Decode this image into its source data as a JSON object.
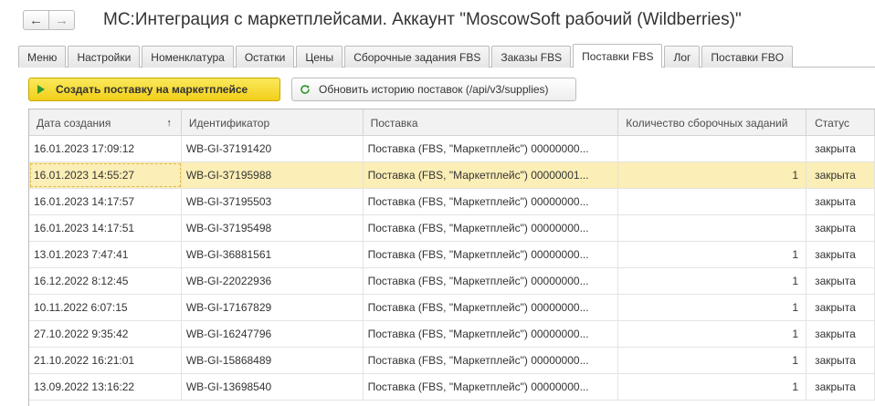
{
  "window": {
    "title": "МС:Интеграция с маркетплейсами. Аккаунт \"MoscowSoft рабочий (Wildberries)\"",
    "back_icon": "arrow-left-icon",
    "forward_icon": "arrow-right-icon"
  },
  "tabs": [
    {
      "label": "Меню",
      "active": false
    },
    {
      "label": "Настройки",
      "active": false
    },
    {
      "label": "Номенклатура",
      "active": false
    },
    {
      "label": "Остатки",
      "active": false
    },
    {
      "label": "Цены",
      "active": false
    },
    {
      "label": "Сборочные задания FBS",
      "active": false
    },
    {
      "label": "Заказы FBS",
      "active": false
    },
    {
      "label": "Поставки FBS",
      "active": true
    },
    {
      "label": "Лог",
      "active": false
    },
    {
      "label": "Поставки FBO",
      "active": false
    }
  ],
  "toolbar": {
    "create_label": "Создать поставку на маркетплейсе",
    "refresh_label": "Обновить историю поставок (/api/v3/supplies)"
  },
  "table": {
    "columns": [
      "Дата создания",
      "Идентификатор",
      "Поставка",
      "Количество сборочных заданий",
      "Статус"
    ],
    "sort_indicator": "↑",
    "rows": [
      {
        "date": "16.01.2023 17:09:12",
        "id": "WB-GI-37191420",
        "supply": "Поставка (FBS, \"Маркетплейс\") 00000000...",
        "count": "",
        "status": "закрыта"
      },
      {
        "date": "16.01.2023 14:55:27",
        "id": "WB-GI-37195988",
        "supply": "Поставка (FBS, \"Маркетплейс\") 00000001...",
        "count": "1",
        "status": "закрыта"
      },
      {
        "date": "16.01.2023 14:17:57",
        "id": "WB-GI-37195503",
        "supply": "Поставка (FBS, \"Маркетплейс\") 00000000...",
        "count": "",
        "status": "закрыта"
      },
      {
        "date": "16.01.2023 14:17:51",
        "id": "WB-GI-37195498",
        "supply": "Поставка (FBS, \"Маркетплейс\") 00000000...",
        "count": "",
        "status": "закрыта"
      },
      {
        "date": "13.01.2023 7:47:41",
        "id": "WB-GI-36881561",
        "supply": "Поставка (FBS, \"Маркетплейс\") 00000000...",
        "count": "1",
        "status": "закрыта"
      },
      {
        "date": "16.12.2022 8:12:45",
        "id": "WB-GI-22022936",
        "supply": "Поставка (FBS, \"Маркетплейс\") 00000000...",
        "count": "1",
        "status": "закрыта"
      },
      {
        "date": "10.11.2022 6:07:15",
        "id": "WB-GI-17167829",
        "supply": "Поставка (FBS, \"Маркетплейс\") 00000000...",
        "count": "1",
        "status": "закрыта"
      },
      {
        "date": "27.10.2022 9:35:42",
        "id": "WB-GI-16247796",
        "supply": "Поставка (FBS, \"Маркетплейс\") 00000000...",
        "count": "1",
        "status": "закрыта"
      },
      {
        "date": "21.10.2022 16:21:01",
        "id": "WB-GI-15868489",
        "supply": "Поставка (FBS, \"Маркетплейс\") 00000000...",
        "count": "1",
        "status": "закрыта"
      },
      {
        "date": "13.09.2022 13:16:22",
        "id": "WB-GI-13698540",
        "supply": "Поставка (FBS, \"Маркетплейс\") 00000000...",
        "count": "1",
        "status": "закрыта"
      }
    ],
    "selected_row": 1
  },
  "colors": {
    "accent_button": "#f1cf1a",
    "selected_row": "#fbeeb6",
    "play_icon": "#2d9a2d",
    "refresh_icon": "#2d9a2d"
  }
}
